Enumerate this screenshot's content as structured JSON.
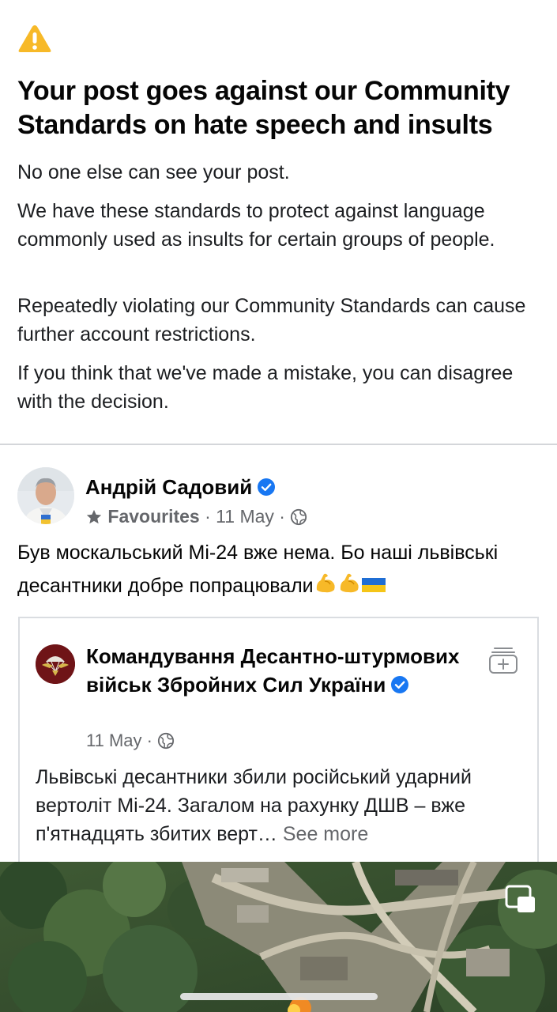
{
  "notice": {
    "headline": "Your post goes against our Community Standards on hate speech and insults",
    "paragraphs": [
      "No one else can see your post.",
      "We have these standards to protect against language commonly used as insults for certain groups of people.",
      "Repeatedly violating our Community Standards can cause further account restrictions.",
      "If you think that we've made a mistake, you can disagree with the decision."
    ],
    "icon": "warning-triangle-icon",
    "icon_color": "#f7b928"
  },
  "post": {
    "author": "Андрій Садовий",
    "audience_label": "Favourites",
    "date": "11 May",
    "separator": "·",
    "text": "Був москальський Мі-24 вже нема. Бо наші львівські десантники добре попрацювали",
    "emojis": [
      "flexed-biceps-emoji",
      "flexed-biceps-emoji",
      "ukraine-flag-emoji"
    ]
  },
  "shared_post": {
    "page_name": "Командування Десантно-штурмових військ Збройних Сил України",
    "date": "11 May",
    "separator": "·",
    "text": "Львівські десантники збили російський ударний вертоліт Мі-24. Загалом на рахунку ДШВ – вже п'ятнадцять збитих верт…",
    "see_more": "See more"
  },
  "colors": {
    "verified": "#1877f2",
    "secondary_text": "#65676b",
    "divider": "#d4d6da"
  }
}
